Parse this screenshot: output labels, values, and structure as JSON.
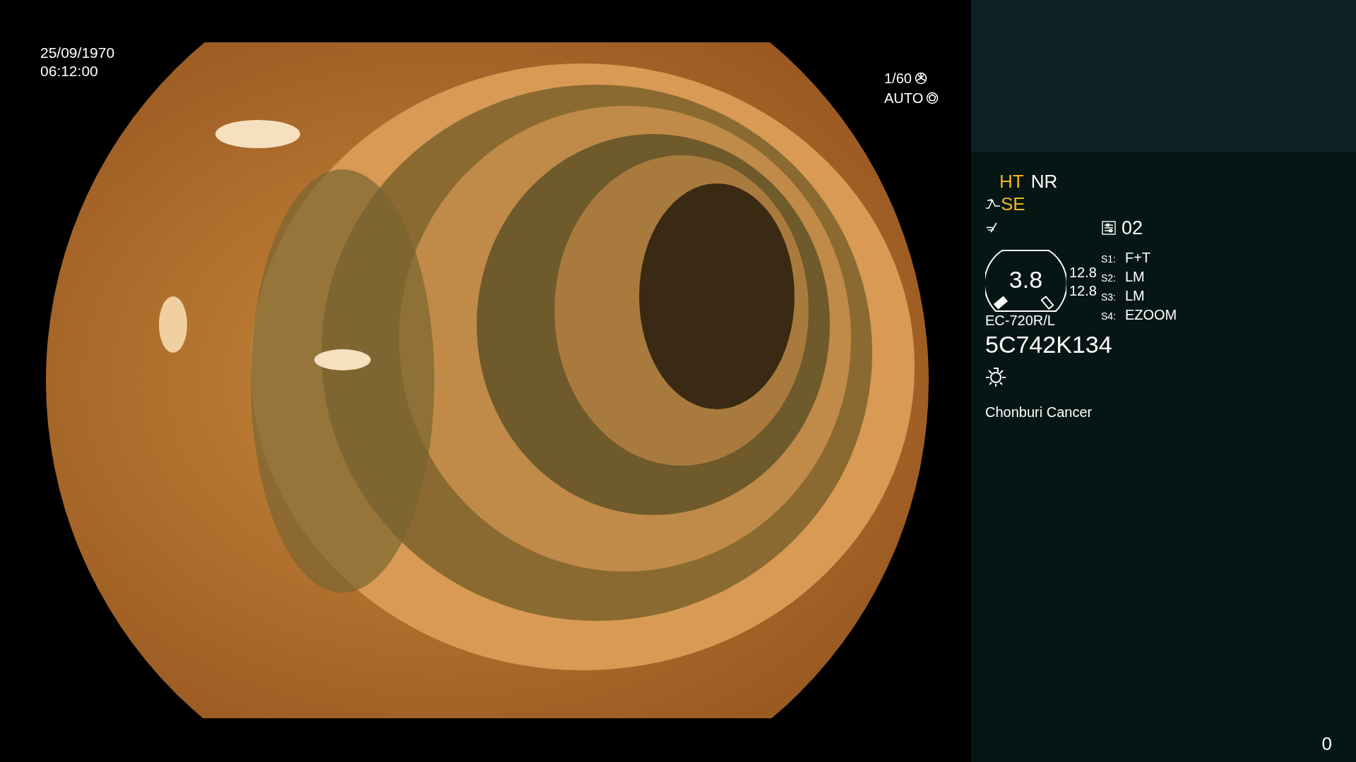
{
  "image_overlay": {
    "date": "25/09/1970",
    "time": "06:12:00",
    "shutter": "1/60",
    "iris": "AUTO"
  },
  "panel": {
    "modes": [
      {
        "label": "HT",
        "active": true
      },
      {
        "label": "NR",
        "active": false
      }
    ],
    "enhance": {
      "label": "SE",
      "active": true
    },
    "preset": "02",
    "gauge": {
      "value": "3.8",
      "readings": [
        "12.8",
        "12.8"
      ]
    },
    "switches": [
      {
        "key": "S1:",
        "value": "F+T"
      },
      {
        "key": "S2:",
        "value": "LM"
      },
      {
        "key": "S3:",
        "value": "LM"
      },
      {
        "key": "S4:",
        "value": "EZOOM"
      }
    ],
    "scope_model": "EC-720R/L",
    "serial": "5C742K134",
    "institution": "Chonburi Cancer",
    "counter": "0"
  }
}
